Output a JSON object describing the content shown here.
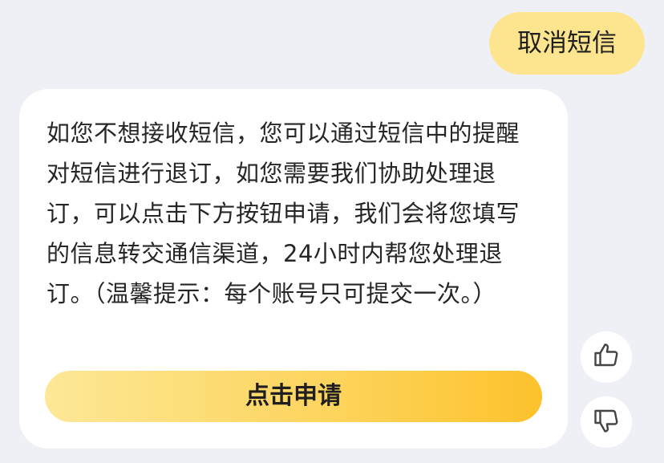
{
  "user_message": {
    "text": "取消短信"
  },
  "bot_message": {
    "text": "如您不想接收短信，您可以通过短信中的提醒对短信进行退订，如您需要我们协助处理退订，可以点击下方按钮申请，我们会将您填写的信息转交通信渠道，24小时内帮您处理退订。（温馨提示：每个账号只可提交一次。）",
    "button_label": "点击申请"
  },
  "feedback": {
    "like_icon": "thumbs-up-icon",
    "dislike_icon": "thumbs-down-icon"
  },
  "colors": {
    "background": "#eef0f5",
    "user_bubble": "#fde58f",
    "button_gradient_start": "#fde897",
    "button_gradient_end": "#fdc22c"
  }
}
